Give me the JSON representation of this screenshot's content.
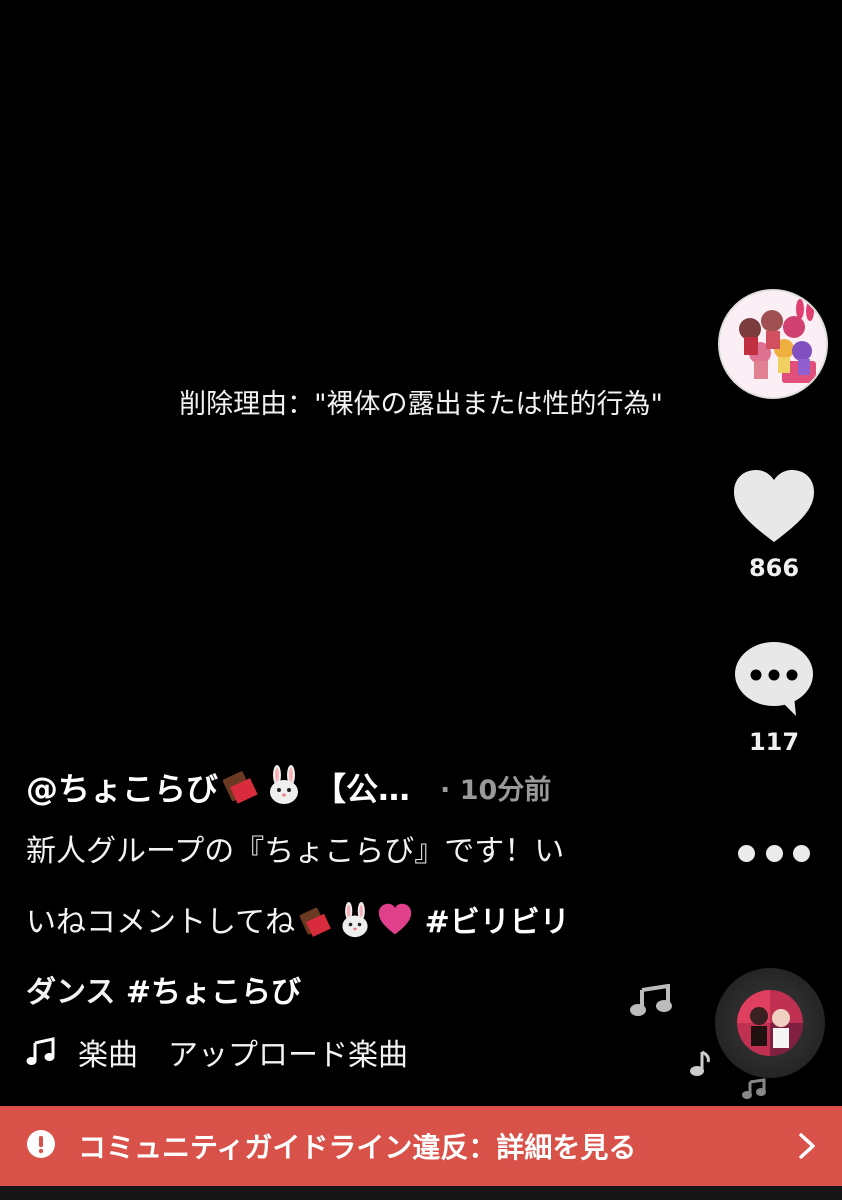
{
  "removal_notice": "削除理由：\"裸体の露出または性的行為\"",
  "actions": {
    "like_count": "866",
    "comment_count": "117"
  },
  "post": {
    "username": "@ちょこらび",
    "username_suffix": "【公…",
    "timestamp": "· 10分前",
    "caption_line1": "新人グループの『ちょこらび』です！い",
    "caption_line2_text": "いねコメントしてね",
    "caption_line2_hashtag": "#ビリビリ",
    "caption_line3_text": "ダンス ",
    "caption_line3_hashtag": "#ちょこらび",
    "music": "楽曲　アップロード楽曲"
  },
  "banner": {
    "text": "コミュニティガイドライン違反：詳細を見る"
  },
  "colors": {
    "background": "#000000",
    "banner": "#d9524a",
    "timestamp": "#9a9a9a"
  },
  "icons": [
    "heart-icon",
    "comment-bubble-icon",
    "more-dots-icon",
    "music-note-icon",
    "alert-icon",
    "chevron-right-icon",
    "chocolate-emoji",
    "rabbit-emoji",
    "heart-emoji"
  ]
}
